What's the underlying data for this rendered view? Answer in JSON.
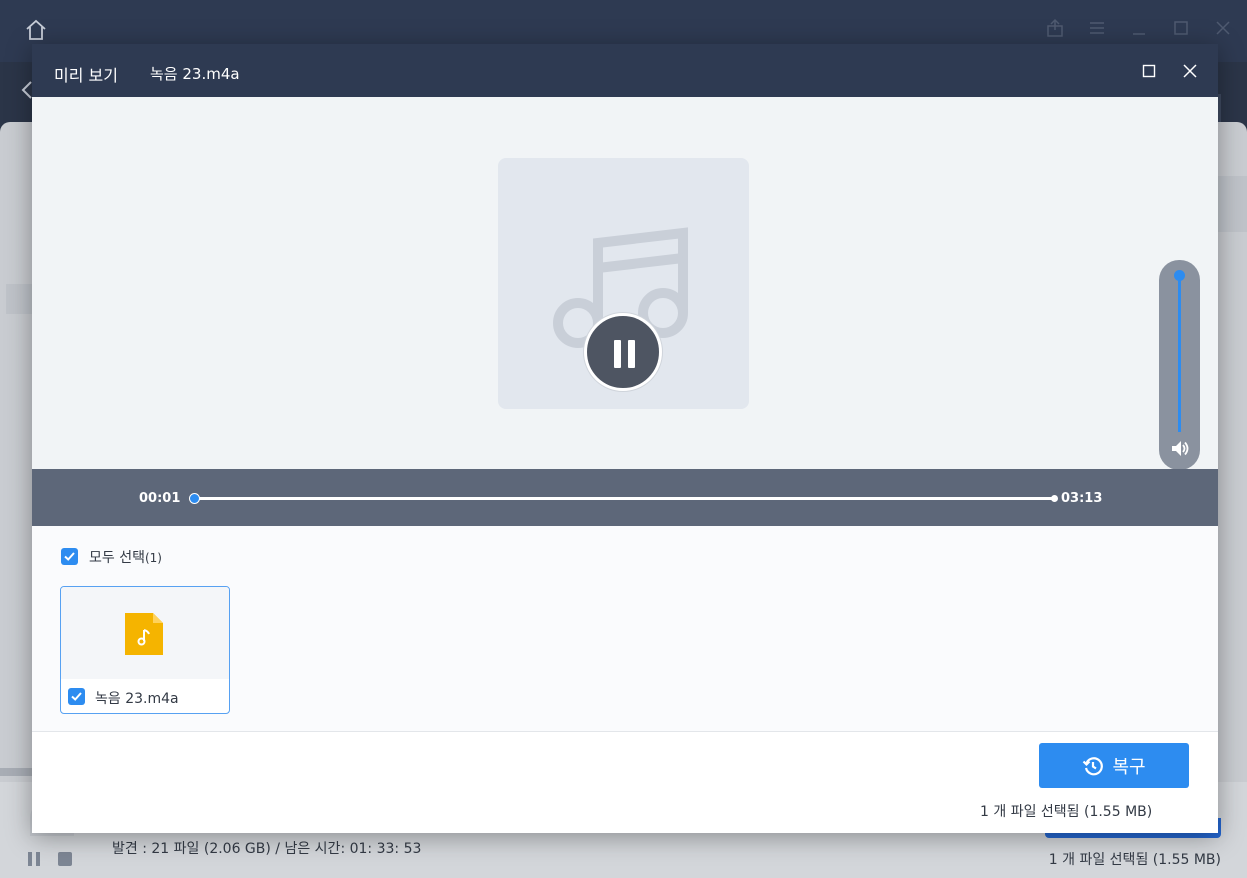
{
  "app": {
    "status_text": "발견 : 21 파일 (2.06 GB) / 남은 시간: 01: 33: 53",
    "selected_text": "1 개 파일 선택됨 (1.55 MB)"
  },
  "modal": {
    "title": "미리 보기",
    "filename": "녹음 23.m4a"
  },
  "player": {
    "current_time": "00:01",
    "total_time": "03:13",
    "progress": 0.005,
    "volume": 1.0,
    "state": "playing"
  },
  "files": {
    "select_all_label": "모두 선택",
    "select_all_count": "(1)",
    "select_all_checked": true,
    "items": [
      {
        "name": "녹음 23.m4a",
        "checked": true,
        "icon": "audio-file-icon"
      }
    ]
  },
  "footer": {
    "recover_label": "복구",
    "selected_info": "1 개 파일 선택됨 (1.55 MB)"
  },
  "colors": {
    "header_bg": "#2e3a52",
    "accent": "#2d8cf0",
    "seekbar_bg": "#5d6779",
    "file_icon": "#f5b400"
  }
}
